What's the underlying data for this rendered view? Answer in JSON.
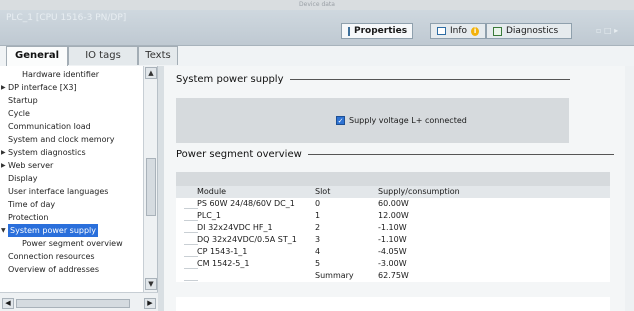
{
  "window": {
    "title": "Device data"
  },
  "object_title": "PLC_1 [CPU 1516-3 PN/DP]",
  "panel_tabs": [
    {
      "label": "Properties",
      "icon": "properties-icon"
    },
    {
      "label": "Info",
      "icon": "info-icon"
    },
    {
      "label": "Diagnostics",
      "icon": "diagnostics-icon"
    }
  ],
  "window_controls": "▫ □ ▸",
  "tabs": [
    {
      "label": "General",
      "active": true
    },
    {
      "label": "IO tags",
      "active": false
    },
    {
      "label": "Texts",
      "active": false
    }
  ],
  "nav": [
    {
      "label": "Hardware identifier",
      "level": 1,
      "arrow": ""
    },
    {
      "label": "DP interface [X3]",
      "level": 0,
      "arrow": "▶"
    },
    {
      "label": "Startup",
      "level": 0,
      "arrow": ""
    },
    {
      "label": "Cycle",
      "level": 0,
      "arrow": ""
    },
    {
      "label": "Communication load",
      "level": 0,
      "arrow": ""
    },
    {
      "label": "System and clock memory",
      "level": 0,
      "arrow": ""
    },
    {
      "label": "System diagnostics",
      "level": 0,
      "arrow": "▶"
    },
    {
      "label": "Web server",
      "level": 0,
      "arrow": "▶"
    },
    {
      "label": "Display",
      "level": 0,
      "arrow": ""
    },
    {
      "label": "User interface languages",
      "level": 0,
      "arrow": ""
    },
    {
      "label": "Time of day",
      "level": 0,
      "arrow": ""
    },
    {
      "label": "Protection",
      "level": 0,
      "arrow": ""
    },
    {
      "label": "System power supply",
      "level": 0,
      "arrow": "▼",
      "selected": true
    },
    {
      "label": "Power segment overview",
      "level": 1,
      "arrow": ""
    },
    {
      "label": "Connection resources",
      "level": 0,
      "arrow": ""
    },
    {
      "label": "Overview of addresses",
      "level": 0,
      "arrow": ""
    }
  ],
  "system_power_supply": {
    "heading": "System power supply",
    "checkbox_label": "Supply voltage L+ connected",
    "checked": true
  },
  "power_segment": {
    "heading": "Power segment overview",
    "columns": [
      "Module",
      "Slot",
      "Supply/consumption"
    ],
    "rows": [
      [
        "PS 60W 24/48/60V DC_1",
        "0",
        "60.00W"
      ],
      [
        "PLC_1",
        "1",
        "12.00W"
      ],
      [
        "DI 32x24VDC HF_1",
        "2",
        "-1.10W"
      ],
      [
        "DQ 32x24VDC/0.5A ST_1",
        "3",
        "-1.10W"
      ],
      [
        "CP 1543-1_1",
        "4",
        "-4.05W"
      ],
      [
        "CM 1542-5_1",
        "5",
        "-3.00W"
      ],
      [
        "",
        "Summary",
        "62.75W"
      ]
    ]
  },
  "colors": {
    "selection": "#2a6fdb",
    "checkbox": "#2e72d2",
    "title_band": "#c5d0d8"
  }
}
